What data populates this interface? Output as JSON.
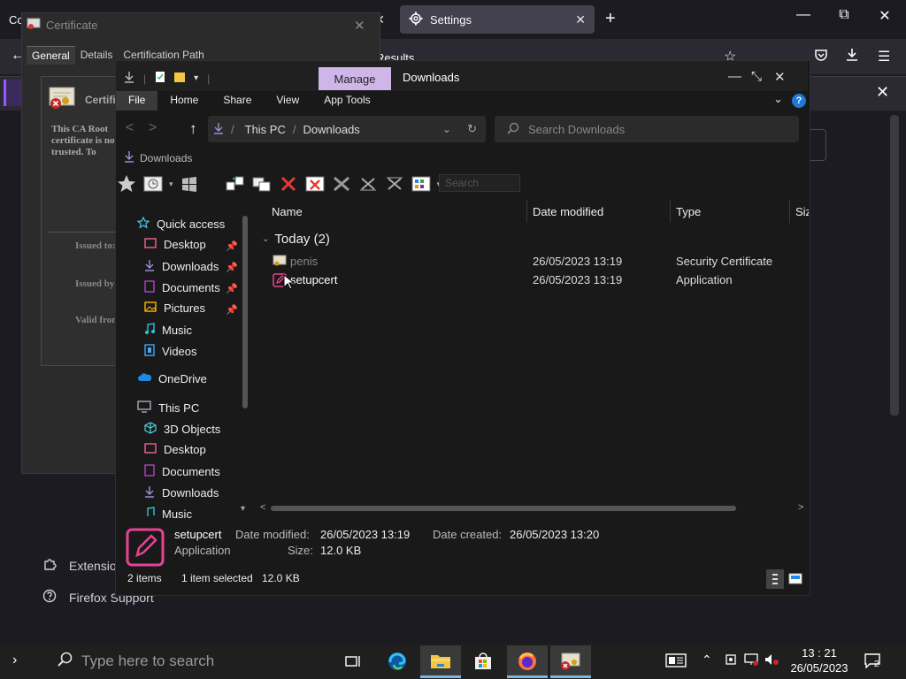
{
  "firefox": {
    "tab_inactive_label": "Co",
    "tab_active_label": "Settings",
    "tab_close": "✕",
    "newtab": "+",
    "results_text": "Results",
    "sidebar_extensions": "Extensions & Themes",
    "sidebar_support": "Firefox Support",
    "window_controls": {
      "minimize": "—",
      "maximize": "⧉",
      "close": "✕"
    }
  },
  "certificate": {
    "title": "Certificate",
    "tabs": [
      "General",
      "Details",
      "Certification Path"
    ],
    "info_title": "Certificate Information",
    "body_text": "This CA Root certificate is not trusted. To enable trust, install this certificate in the Trusted Root Certification Authorities store.",
    "issued_to": "Issued to:",
    "issued_by": "Issued by:",
    "valid_from": "Valid from"
  },
  "explorer": {
    "title": "Downloads",
    "manage_label": "Manage",
    "ribbon_tabs": [
      "File",
      "Home",
      "Share",
      "View",
      "App Tools"
    ],
    "help": "?",
    "address": {
      "root": "This PC",
      "sep": "/",
      "current": "Downloads"
    },
    "search_placeholder": "Search Downloads",
    "secondary_breadcrumb": "Downloads",
    "toolbar_search_placeholder": "Search",
    "nav": [
      {
        "label": "Quick access",
        "icon": "star-icon"
      },
      {
        "label": "Desktop",
        "icon": "desktop-icon",
        "pinned": true
      },
      {
        "label": "Downloads",
        "icon": "downloads-icon",
        "pinned": true
      },
      {
        "label": "Documents",
        "icon": "documents-icon",
        "pinned": true
      },
      {
        "label": "Pictures",
        "icon": "pictures-icon",
        "pinned": true
      },
      {
        "label": "Music",
        "icon": "music-icon"
      },
      {
        "label": "Videos",
        "icon": "videos-icon"
      },
      {
        "label": "OneDrive",
        "icon": "cloud-icon"
      },
      {
        "label": "This PC",
        "icon": "computer-icon"
      },
      {
        "label": "3D Objects",
        "icon": "cube-icon"
      },
      {
        "label": "Desktop",
        "icon": "desktop-icon"
      },
      {
        "label": "Documents",
        "icon": "documents-icon"
      },
      {
        "label": "Downloads",
        "icon": "downloads-icon"
      },
      {
        "label": "Music",
        "icon": "music-icon"
      }
    ],
    "columns": [
      "Name",
      "Date modified",
      "Type",
      "Size"
    ],
    "group_label": "Today (2)",
    "files": [
      {
        "name": "penis",
        "date": "26/05/2023 13:19",
        "type": "Security Certificate"
      },
      {
        "name": "setupcert",
        "date": "26/05/2023 13:19",
        "type": "Application"
      }
    ],
    "details": {
      "name": "setupcert",
      "kind": "Application",
      "date_modified_label": "Date modified:",
      "date_modified": "26/05/2023 13:19",
      "size_label": "Size:",
      "size": "12.0 KB",
      "date_created_label": "Date created:",
      "date_created": "26/05/2023 13:20"
    },
    "status": {
      "items": "2 items",
      "selected": "1 item selected",
      "size": "12.0 KB"
    }
  },
  "taskbar": {
    "search_placeholder": "Type here to search",
    "time": "13 : 21",
    "date": "26/05/2023",
    "notification_count": "2",
    "active_accent": "#76b9ed"
  }
}
